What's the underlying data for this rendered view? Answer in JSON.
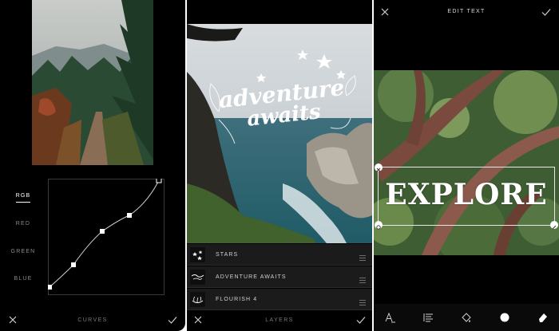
{
  "curves_screen": {
    "channels": [
      "RGB",
      "RED",
      "GREEN",
      "BLUE"
    ],
    "active_channel": "RGB",
    "title": "CURVES"
  },
  "layers_screen": {
    "overlay_text_line1": "adventure",
    "overlay_text_line2": "awaits",
    "layers": [
      {
        "label": "STARS",
        "thumb_icon": "stars-thumbnail-icon"
      },
      {
        "label": "ADVENTURE AWAITS",
        "thumb_icon": "adventure-awaits-thumbnail-icon"
      },
      {
        "label": "FLOURISH 4",
        "thumb_icon": "flourish-thumbnail-icon"
      }
    ],
    "title": "LAYERS"
  },
  "edit_text_screen": {
    "title": "EDIT TEXT",
    "overlay_text": "EXPLORE",
    "tools": [
      "text-font-icon",
      "text-align-icon",
      "fill-color-icon",
      "opacity-icon",
      "eraser-icon"
    ]
  },
  "colors": {
    "background": "#000000",
    "bar_text": "#7a7a7a",
    "row_background": "#1b1b1b",
    "accent": "#ffffff"
  }
}
